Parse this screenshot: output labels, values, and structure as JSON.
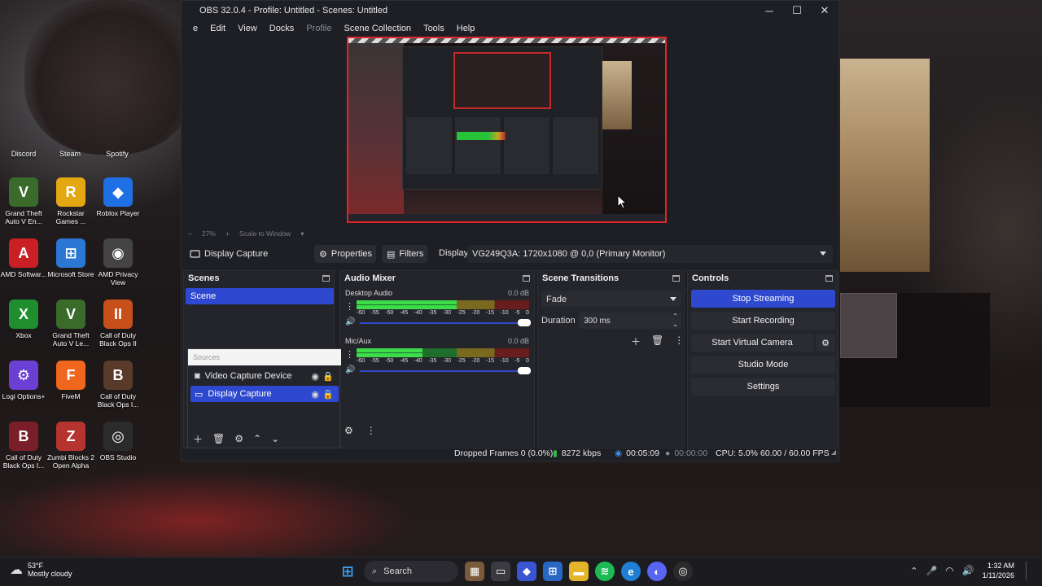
{
  "window": {
    "title": "OBS 32.0.4 - Profile: Untitled - Scenes: Untitled",
    "controls": {
      "minimize": "─",
      "maximize": "☐",
      "close": "✕"
    }
  },
  "menu": [
    "e",
    "Edit",
    "View",
    "Docks",
    "Profile",
    "Scene Collection",
    "Tools",
    "Help"
  ],
  "preview": {
    "zoom": "27%",
    "scale_mode": "Scale to Window"
  },
  "source_toolbar": {
    "source_name": "Display Capture",
    "properties": "Properties",
    "filters": "Filters",
    "display_label": "Display",
    "display_value": "VG249Q3A: 1720x1080 @ 0,0 (Primary Monitor)"
  },
  "scenes": {
    "title": "Scenes",
    "items": [
      "Scene"
    ]
  },
  "sources": {
    "tab": "Sources",
    "items": [
      {
        "name": "Video Capture Device",
        "icon": "camera-icon",
        "selected": false
      },
      {
        "name": "Display Capture",
        "icon": "monitor-icon",
        "selected": true
      }
    ]
  },
  "mixer": {
    "title": "Audio Mixer",
    "scale_ticks": [
      "-60",
      "-55",
      "-50",
      "-45",
      "-40",
      "-35",
      "-30",
      "-25",
      "-20",
      "-15",
      "-10",
      "-5",
      "0"
    ],
    "channels": [
      {
        "name": "Desktop Audio",
        "db": "0.0 dB",
        "level": 0.58
      },
      {
        "name": "Mic/Aux",
        "db": "0.0 dB",
        "level": 0.38
      }
    ]
  },
  "transitions": {
    "title": "Scene Transitions",
    "type": "Fade",
    "duration_label": "Duration",
    "duration_value": "300 ms"
  },
  "controls": {
    "title": "Controls",
    "stop_streaming": "Stop Streaming",
    "start_recording": "Start Recording",
    "start_virtual_camera": "Start Virtual Camera",
    "studio_mode": "Studio Mode",
    "settings": "Settings"
  },
  "status": {
    "dropped_frames": "Dropped Frames 0 (0.0%)",
    "bitrate": "8272 kbps",
    "stream_time": "00:05:09",
    "record_time": "00:00:00",
    "cpu": "CPU: 5.0%",
    "fps": "60.00 / 60.00 FPS"
  },
  "desktop": {
    "top_labels": [
      "Discord",
      "Steam",
      "Spotify"
    ],
    "icons": [
      {
        "label": "Grand Theft Auto V En...",
        "glyph": "V",
        "color": "#3a6b2a"
      },
      {
        "label": "Rockstar Games ...",
        "glyph": "R",
        "color": "#e3a712"
      },
      {
        "label": "Roblox Player",
        "glyph": "◆",
        "color": "#1f6fe5"
      },
      {
        "label": "AMD Softwar...",
        "glyph": "A",
        "color": "#c91f25"
      },
      {
        "label": "Microsoft Store",
        "glyph": "⊞",
        "color": "#2a77d4"
      },
      {
        "label": "AMD Privacy View",
        "glyph": "◉",
        "color": "#444"
      },
      {
        "label": "Xbox",
        "glyph": "X",
        "color": "#1e8e2e"
      },
      {
        "label": "Grand Theft Auto V Le...",
        "glyph": "V",
        "color": "#3a6b2a"
      },
      {
        "label": "Call of Duty Black Ops II",
        "glyph": "II",
        "color": "#c7501a"
      },
      {
        "label": "Logi Options+",
        "glyph": "⚙",
        "color": "#6b3fd4"
      },
      {
        "label": "FiveM",
        "glyph": "F",
        "color": "#f0661d"
      },
      {
        "label": "Call of Duty Black Ops I...",
        "glyph": "B",
        "color": "#5a3a2a"
      },
      {
        "label": "Call of Duty Black Ops I...",
        "glyph": "B",
        "color": "#7a1f2a"
      },
      {
        "label": "Zumbi Blocks 2 Open Alpha",
        "glyph": "Z",
        "color": "#b6342f"
      },
      {
        "label": "OBS Studio",
        "glyph": "◎",
        "color": "#2b2b2b"
      }
    ]
  },
  "taskbar": {
    "weather_temp": "53°F",
    "weather_desc": "Mostly cloudy",
    "search_label": "Search",
    "time": "1:32 AM",
    "date": "1/11/2026"
  }
}
